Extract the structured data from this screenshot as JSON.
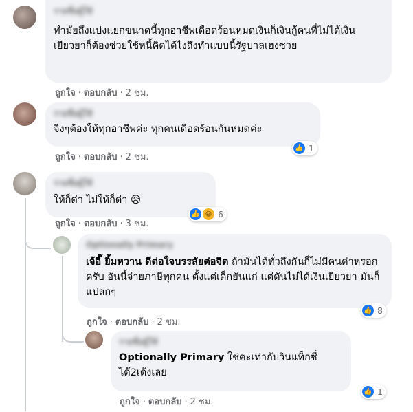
{
  "comments": [
    {
      "author": "รายชื่อผู้ใช้",
      "text": "ทำมัยถึงแบ่งแยกขนาดนี้ทุกอาชีพเดือดร้อนหมดเงินก็เงินกู้คนที่ไม่ได้เงินเยียวยาก็ต้องช่วยใช้หนี้คิดได้ไงถึงทำแบบนี้รัฐบาลเฮงซวย",
      "like": "ถูกใจ",
      "reply": "ตอบกลับ",
      "time": "2 ชม."
    },
    {
      "author": "รายชื่อผู้ใช้",
      "text": "จิงๆต้องให้ทุกอาชีพค่ะ ทุกคนเดือดร้อนกันหมดค่ะ",
      "like": "ถูกใจ",
      "reply": "ตอบกลับ",
      "time": "2 ชม.",
      "reaction_count": "1"
    },
    {
      "author": "รายชื่อผู้ใช้",
      "text": "ให้ก็ด่า ไม่ให้ก็ด่า 😥",
      "like": "ถูกใจ",
      "reply": "ตอบกลับ",
      "time": "3 ชม.",
      "reaction_count": "6"
    },
    {
      "author": "Optionally Primary",
      "tag": "เจ้อี๊ ยิ้มหวาน ดีต่อใจบรรลัยต่อจิต",
      "text": " ถ้ามันได้ทั่วถึงกันก็ไม่มีคนด่าหรอกครับ อันนี้จ่ายภาษีทุกคน ตั้งแต่เด็กยันแก่ แต่ดันไม่ได้เงินเยียวยา มันก็แปลกๆ",
      "like": "ถูกใจ",
      "reply": "ตอบกลับ",
      "time": "2 ชม.",
      "reaction_count": "8"
    },
    {
      "author": "รายชื่อผู้ใช้",
      "tag": "Optionally Primary",
      "text": " ใช่คะเท่ากับวินแท็กซี่ได้2เด้งเลย",
      "like": "ถูกใจ",
      "reply": "ตอบกลับ",
      "time": "2 ชม.",
      "reaction_count": "1"
    }
  ],
  "separator": "·",
  "colors": {
    "bubble": "#f0f2f5",
    "meta": "#65676b",
    "like": "#1877f2",
    "haha": "#f7b125"
  },
  "icons": {
    "like": "like-reaction-icon",
    "haha": "haha-reaction-icon"
  }
}
